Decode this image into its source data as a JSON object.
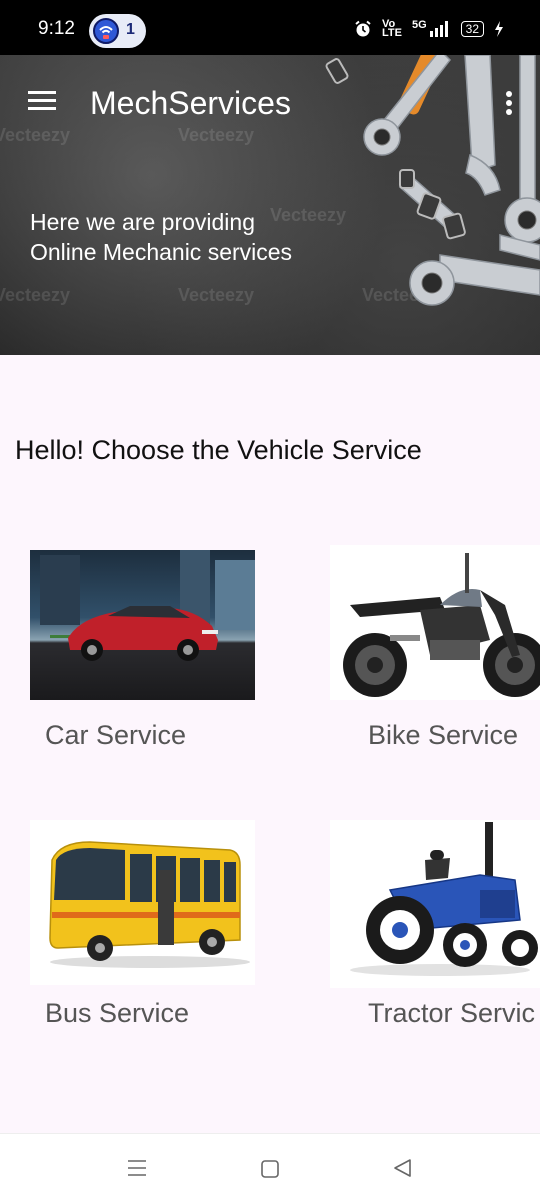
{
  "status_bar": {
    "time": "9:12",
    "hotspot_count": "1",
    "net1": "Vo",
    "net2": "LTE",
    "net3": "5G",
    "battery": "32"
  },
  "header": {
    "app_title": "MechServices",
    "tagline_line1": "Here we are providing",
    "tagline_line2": "Online Mechanic services",
    "watermark": "Vecteezy"
  },
  "content": {
    "title": "Hello! Choose the Vehicle Service"
  },
  "services": [
    {
      "label": "Car Service",
      "icon": "car-icon"
    },
    {
      "label": "Bike Service",
      "icon": "motorcycle-icon"
    },
    {
      "label": "Bus Service",
      "icon": "bus-icon"
    },
    {
      "label": "Tractor Servic",
      "icon": "tractor-icon"
    }
  ],
  "colors": {
    "background": "#fdf6fd",
    "car": "#c0202a",
    "bus": "#f2c21c",
    "tractor": "#2a55b8"
  }
}
